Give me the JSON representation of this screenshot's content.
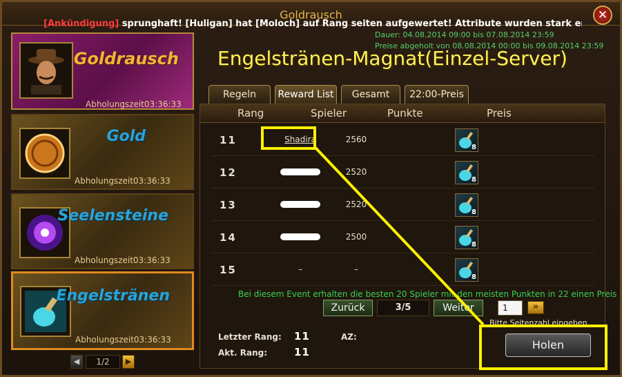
{
  "window": {
    "title": "Goldrausch",
    "close": "✕"
  },
  "announcement": {
    "tag": "[Ankündigung]",
    "text": " sprunghaft! [Huligan] hat [Moloch] auf Rang seiten aufgewertet! Attribute wurden stark erhöht!"
  },
  "sidebar": {
    "cards": [
      {
        "title": "Goldrausch",
        "time": "Abholungszeit03:36:33",
        "icon": "man-with-hat-portrait-icon"
      },
      {
        "title": "Gold",
        "time": "Abholungszeit03:36:33",
        "icon": "gold-coin-icon"
      },
      {
        "title": "Seelensteine",
        "time": "Abholungszeit03:36:33",
        "icon": "purple-soul-orb-icon"
      },
      {
        "title": "Engelstränen",
        "time": "Abholungszeit03:36:33",
        "icon": "angel-tear-potion-icon"
      }
    ],
    "pager": {
      "prev": "◀",
      "value": "1/2",
      "next": "▶"
    }
  },
  "event": {
    "duration": "Dauer: 04.08.2014 09:00 bis 07.08.2014 23:59",
    "rewards": "Preise abgeholt von 08.08.2014 00:00 bis 09.08.2014 23:59",
    "title": "Engelstränen-Magnat(Einzel-Server)"
  },
  "tabs": [
    "Regeln",
    "Reward List",
    "Gesamt",
    "22:00-Preis"
  ],
  "table": {
    "headers": {
      "rank": "Rang",
      "player": "Spieler",
      "points": "Punkte",
      "prize": "Preis"
    },
    "rows": [
      {
        "rank": "11",
        "player": "Shadira",
        "points": "2560",
        "prize_count": "8",
        "redacted": false
      },
      {
        "rank": "12",
        "player": "",
        "points": "2520",
        "prize_count": "8",
        "redacted": true
      },
      {
        "rank": "13",
        "player": "",
        "points": "2520",
        "prize_count": "8",
        "redacted": true
      },
      {
        "rank": "14",
        "player": "",
        "points": "2500",
        "prize_count": "8",
        "redacted": true
      },
      {
        "rank": "15",
        "player": "–",
        "points": "–",
        "prize_count": "8",
        "redacted": false
      }
    ]
  },
  "info": "Bei diesem Event erhalten die besten 20 Spieler mit den meisten Punkten in 22 einen Preis",
  "pagination": {
    "back": "Zurück",
    "page": "3/5",
    "next": "Weiter",
    "input": "1",
    "go": "»",
    "hint": "Bitte Seitenzahl eingeben"
  },
  "stats": {
    "last_rank_label": "Letzter Rang:",
    "last_rank": "11",
    "cur_rank_label": "Akt. Rang:",
    "cur_rank": "11",
    "az_label": "AZ:"
  },
  "collect": "Holen",
  "colors": {
    "highlight": "#fff200",
    "accent_gold": "#f2b437",
    "info_green": "#3ad24f"
  }
}
